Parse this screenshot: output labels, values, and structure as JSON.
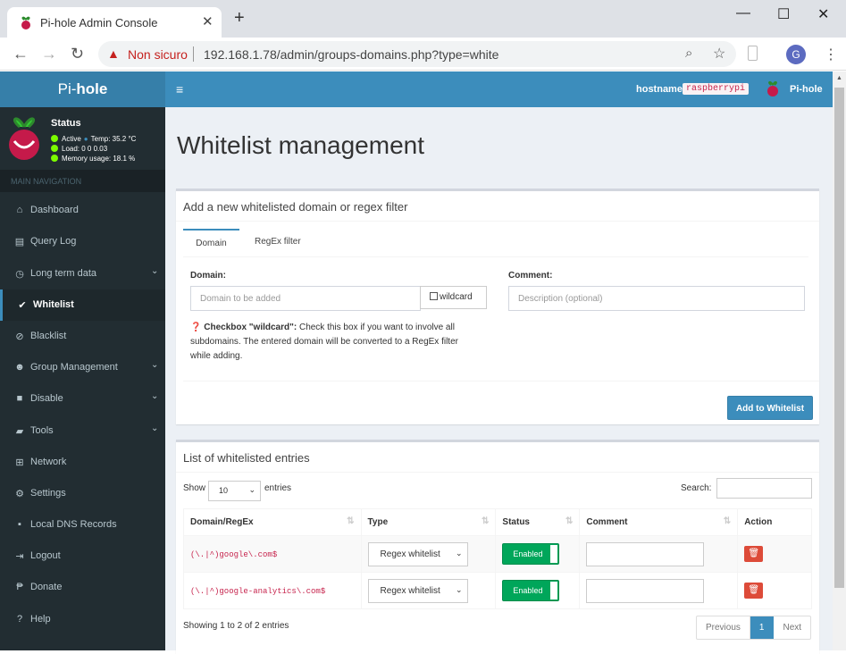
{
  "browser": {
    "tab_title": "Pi-hole Admin Console",
    "close_label": "✕",
    "new_tab_label": "+",
    "window_controls": {
      "minimize": "—",
      "maximize": "☐",
      "close": "✕"
    },
    "security_label": "Non sicuro",
    "url": "192.168.1.78/admin/groups-domains.php?type=white",
    "profile_initial": "G"
  },
  "header": {
    "logo_prefix": "Pi-",
    "logo_bold": "hole",
    "hostname_label": "hostname:",
    "hostname_value": "raspberrypi",
    "brand": "Pi-hole",
    "menu_glyph": "≡"
  },
  "sidebar": {
    "status_title": "Status",
    "status_active": "Active",
    "temp": "Temp: 35.2 °C",
    "load": "Load:  0  0  0.03",
    "memory": "Memory usage:  18.1 %",
    "nav_header": "MAIN NAVIGATION",
    "items": [
      {
        "label": "Dashboard",
        "icon": "⌂"
      },
      {
        "label": "Query Log",
        "icon": "▤"
      },
      {
        "label": "Long term data",
        "icon": "◷"
      },
      {
        "label": "Whitelist",
        "icon": "✔"
      },
      {
        "label": "Blacklist",
        "icon": "⊘"
      },
      {
        "label": "Group Management",
        "icon": "☻"
      },
      {
        "label": "Disable",
        "icon": "■"
      },
      {
        "label": "Tools",
        "icon": "▰"
      },
      {
        "label": "Network",
        "icon": "⊞"
      },
      {
        "label": "Settings",
        "icon": "⚙"
      },
      {
        "label": "Local DNS Records",
        "icon": "▪"
      },
      {
        "label": "Logout",
        "icon": "⇥"
      },
      {
        "label": "Donate",
        "icon": "₱"
      },
      {
        "label": "Help",
        "icon": "?"
      }
    ],
    "active_index": 3
  },
  "main": {
    "page_title": "Whitelist management",
    "add_box": {
      "title": "Add a new whitelisted domain or regex filter",
      "tab_domain": "Domain",
      "tab_regex": "RegEx filter",
      "domain_label": "Domain:",
      "domain_placeholder": "Domain to be added",
      "wildcard_label": "wildcard",
      "comment_label": "Comment:",
      "comment_placeholder": "Description (optional)",
      "help_bold": "Checkbox \"wildcard\":",
      "help_text": " Check this box if you want to involve all subdomains. The entered domain will be converted to a RegEx filter while adding.",
      "add_button": "Add to Whitelist"
    },
    "list_box": {
      "title": "List of whitelisted entries",
      "show_label": "Show",
      "length_value": "10",
      "entries_label": "entries",
      "search_label": "Search:",
      "columns": [
        "Domain/RegEx",
        "Type",
        "Status",
        "Comment",
        "Action"
      ],
      "rows": [
        {
          "domain": "(\\.|^)google\\.com$",
          "type": "Regex whitelist",
          "status": "Enabled",
          "comment": ""
        },
        {
          "domain": "(\\.|^)google-analytics\\.com$",
          "type": "Regex whitelist",
          "status": "Enabled",
          "comment": ""
        }
      ],
      "info": "Showing 1 to 2 of 2 entries",
      "pager": {
        "previous": "Previous",
        "current": "1",
        "next": "Next"
      }
    }
  },
  "colors": {
    "accent": "#3c8dbc",
    "sidebar_bg": "#222d32",
    "success": "#00a65a",
    "danger": "#dd4b39"
  }
}
